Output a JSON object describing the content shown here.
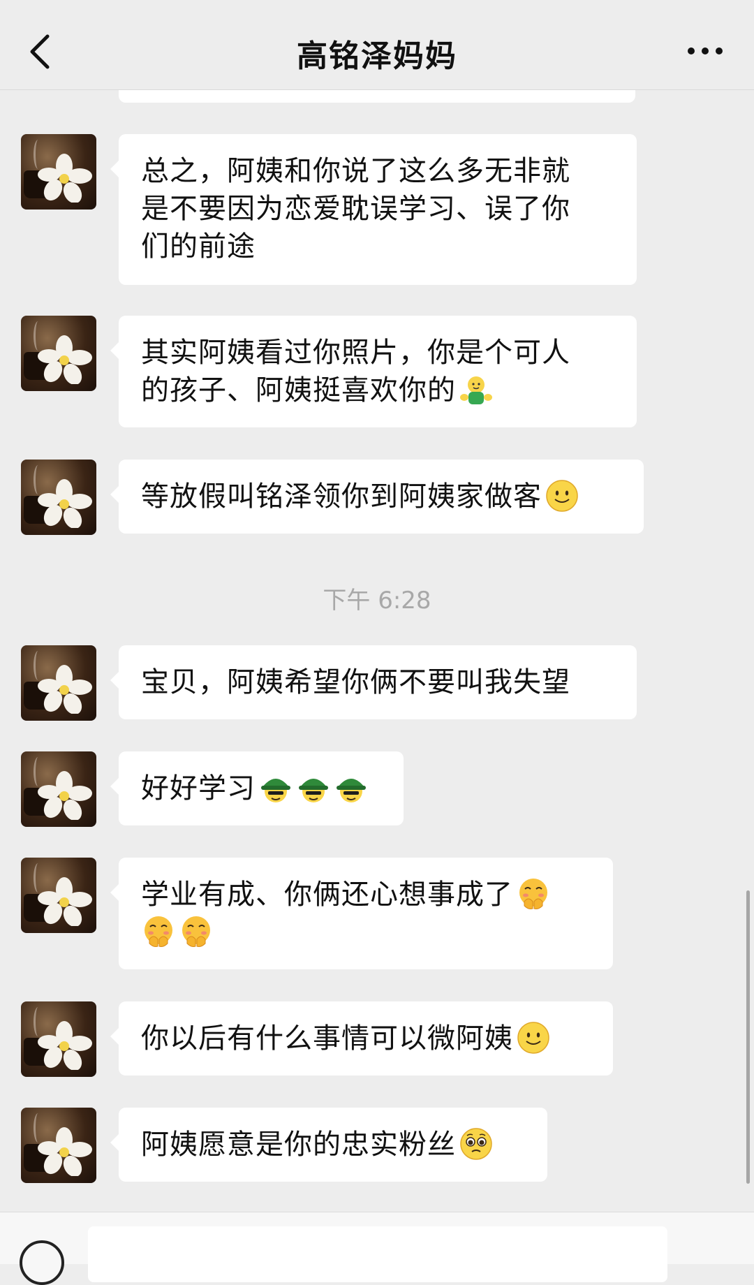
{
  "header": {
    "title": "高铭泽妈妈"
  },
  "timestamp": "下午 6:28",
  "messages": [
    {
      "lines": [
        "总之，阿姨和你说了这么多无非就",
        "是不要因为恋爱耽误学习、误了你",
        "们的前途"
      ],
      "emoji": []
    },
    {
      "lines": [
        "其实阿姨看过你照片，你是个可人",
        "的孩子、阿姨挺喜欢你的"
      ],
      "emoji": [
        "hug-emoji"
      ]
    },
    {
      "lines": [
        "等放假叫铭泽领你到阿姨家做客"
      ],
      "emoji": [
        "smile-emoji"
      ]
    },
    {
      "lines": [
        "宝贝，阿姨希望你俩不要叫我失望"
      ],
      "emoji": []
    },
    {
      "lines": [
        "好好学习"
      ],
      "emoji": [
        "helmet-emoji",
        "helmet-emoji",
        "helmet-emoji"
      ]
    },
    {
      "lines": [
        "学业有成、你俩还心想事成了"
      ],
      "emoji": [
        "giggle-emoji",
        "giggle-emoji",
        "giggle-emoji"
      ]
    },
    {
      "lines": [
        "你以后有什么事情可以微阿姨"
      ],
      "emoji": [
        "smile-emoji"
      ]
    },
    {
      "lines": [
        "阿姨愿意是你的忠实粉丝"
      ],
      "emoji": [
        "pleading-emoji"
      ]
    }
  ],
  "colors": {
    "background": "#ededed",
    "bubble": "#ffffff",
    "timestamp": "#a8a8a8"
  },
  "icons": {
    "back": "chevron-left-icon",
    "more": "more-dots-icon",
    "voice": "voice-icon"
  }
}
